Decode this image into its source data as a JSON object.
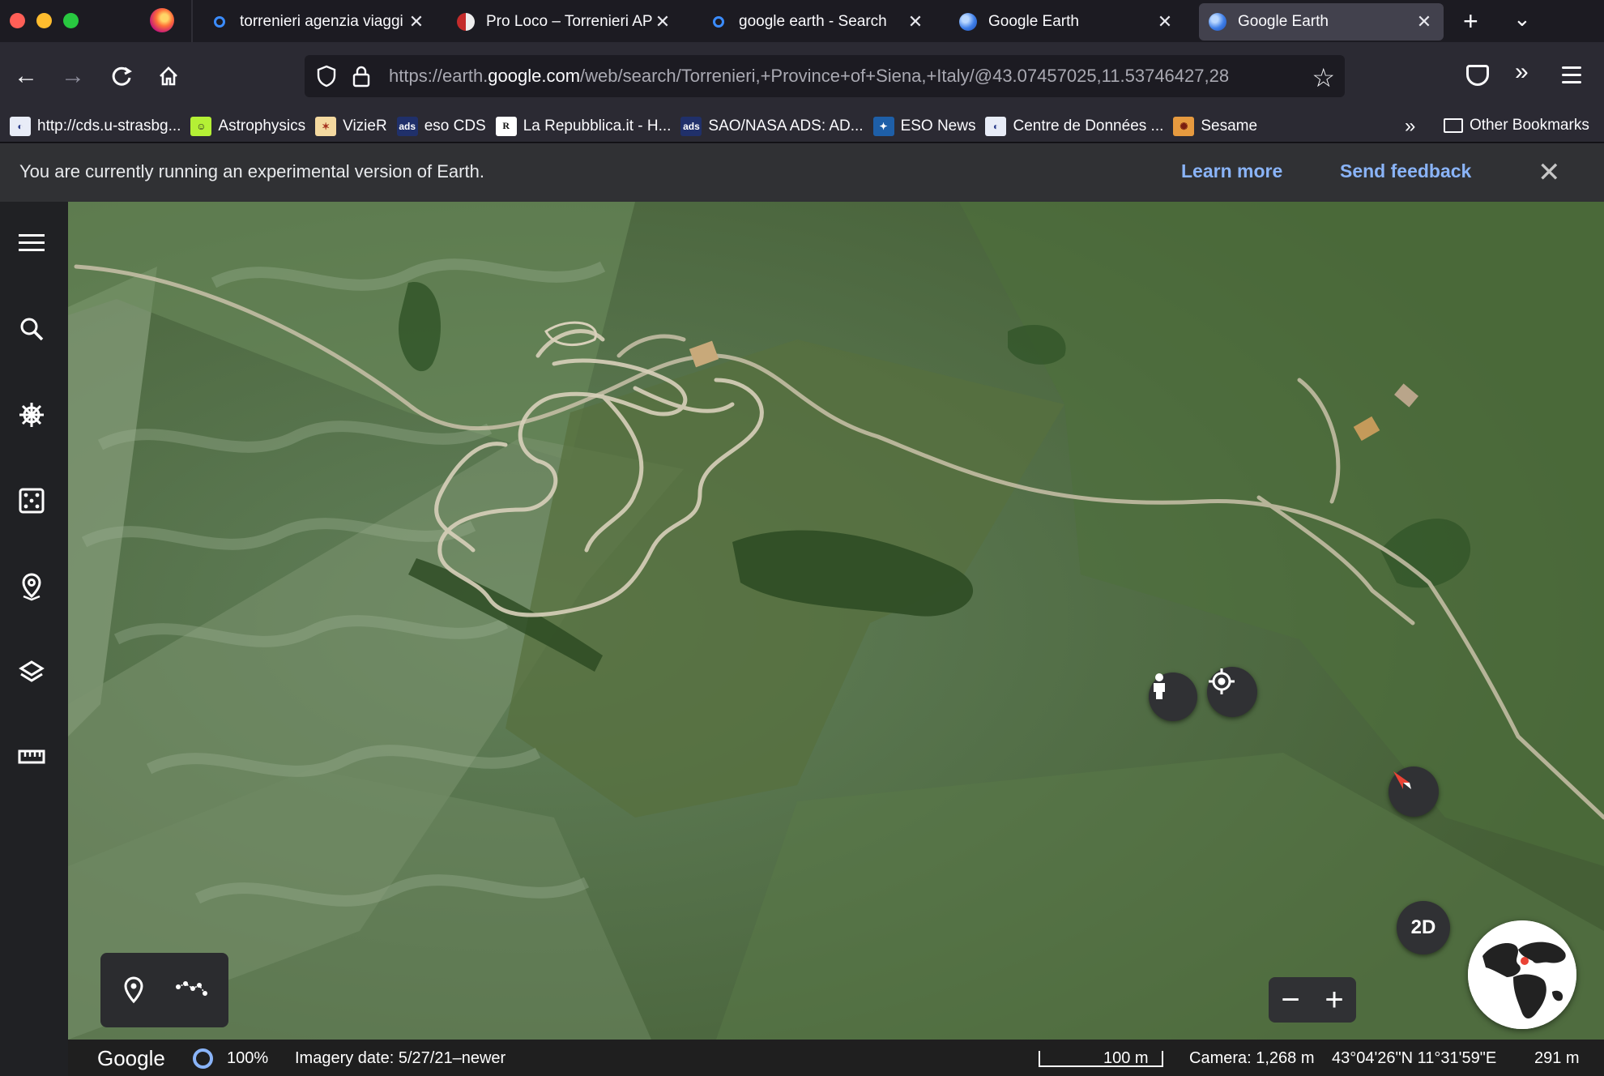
{
  "tabs": [
    {
      "label": "torrenieri agenzia viaggi",
      "favicon": "search-icon",
      "active": false
    },
    {
      "label": "Pro Loco – Torrenieri APS",
      "favicon": "proloco-favicon",
      "active": false
    },
    {
      "label": "google earth - Search",
      "favicon": "search-icon",
      "active": false
    },
    {
      "label": "Google Earth",
      "favicon": "google-earth-favicon",
      "active": false
    },
    {
      "label": "Google Earth",
      "favicon": "google-earth-favicon",
      "active": true
    }
  ],
  "tab_close_glyph": "✕",
  "nav": {
    "url_prefix": "https://earth.",
    "url_domain": "google.com",
    "url_rest": "/web/search/Torrenieri,+Province+of+Siena,+Italy/@43.07457025,11.53746427,28"
  },
  "bookmarks": [
    {
      "label": "http://cds.u-strasbg...",
      "icon": "cds"
    },
    {
      "label": "Astrophysics",
      "icon": "smiley"
    },
    {
      "label": "VizieR",
      "icon": "vizier"
    },
    {
      "label": "eso CDS",
      "icon": "ads"
    },
    {
      "label": "La Repubblica.it - H...",
      "icon": "repubblica"
    },
    {
      "label": "SAO/NASA ADS: AD...",
      "icon": "ads"
    },
    {
      "label": "ESO News",
      "icon": "eso"
    },
    {
      "label": "Centre de Données ...",
      "icon": "cds"
    },
    {
      "label": "Sesame",
      "icon": "sesame"
    }
  ],
  "bookmarks_other": "Other Bookmarks",
  "banner": {
    "message": "You are currently running an experimental version of Earth.",
    "learn_more": "Learn more",
    "send_feedback": "Send feedback"
  },
  "map_controls": {
    "mode_2d": "2D",
    "zoom_out": "−",
    "zoom_in": "+"
  },
  "status": {
    "brand": "Google",
    "load_percent": "100%",
    "imagery_date": "Imagery date: 5/27/21–newer",
    "scale": "100 m",
    "camera": "Camera: 1,268 m",
    "coordinates": "43°04'26\"N 11°31'59\"E",
    "elevation": "291 m"
  },
  "colors": {
    "link": "#8ab4f8",
    "tab_active": "#42414d",
    "toolbar": "#2b2a33"
  }
}
